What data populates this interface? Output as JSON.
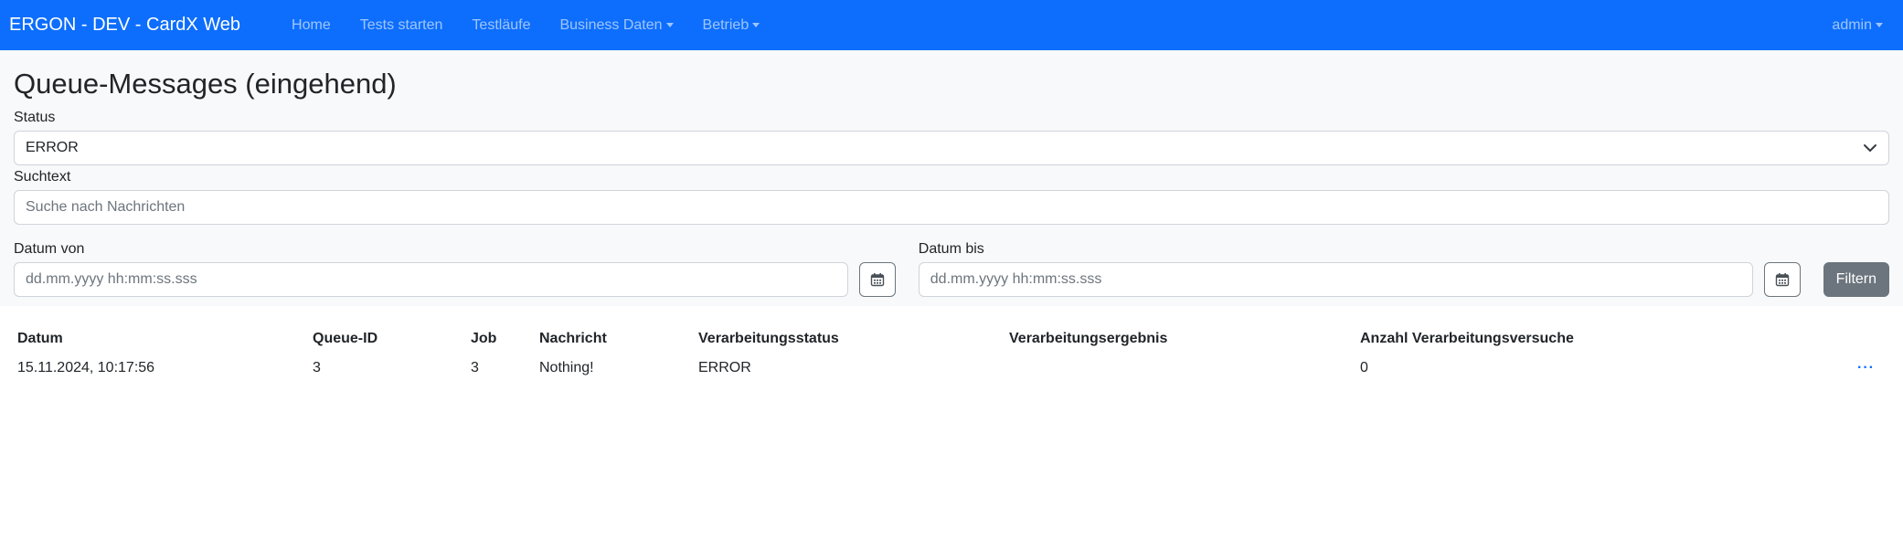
{
  "navbar": {
    "brand": "ERGON - DEV - CardX Web",
    "items": [
      {
        "label": "Home"
      },
      {
        "label": "Tests starten"
      },
      {
        "label": "Testläufe"
      },
      {
        "label": "Business Daten"
      },
      {
        "label": "Betrieb"
      }
    ],
    "user": "admin"
  },
  "page": {
    "title": "Queue-Messages (eingehend)"
  },
  "filters": {
    "status_label": "Status",
    "status_value": "ERROR",
    "search_label": "Suchtext",
    "search_placeholder": "Suche nach Nachrichten",
    "date_from_label": "Datum von",
    "date_from_placeholder": "dd.mm.yyyy hh:mm:ss.sss",
    "date_to_label": "Datum bis",
    "date_to_placeholder": "dd.mm.yyyy hh:mm:ss.sss",
    "filter_button": "Filtern"
  },
  "table": {
    "headers": [
      "Datum",
      "Queue-ID",
      "Job",
      "Nachricht",
      "Verarbeitungsstatus",
      "Verarbeitungsergebnis",
      "Anzahl Verarbeitungsversuche"
    ],
    "rows": [
      {
        "datum": "15.11.2024, 10:17:56",
        "queue_id": "3",
        "job": "3",
        "nachricht": "Nothing!",
        "status": "ERROR",
        "ergebnis": "",
        "versuche": "0",
        "actions": "···"
      }
    ]
  },
  "colors": {
    "navbar": "#0d6efd",
    "panel": "#f8f9fa",
    "filter_button": "#6c757d",
    "action_link": "#0d6efd"
  },
  "icons": {
    "calendar": "calendar-icon",
    "select_chevron": "chevron-down-icon",
    "dropdown_caret": "caret-down-icon"
  }
}
